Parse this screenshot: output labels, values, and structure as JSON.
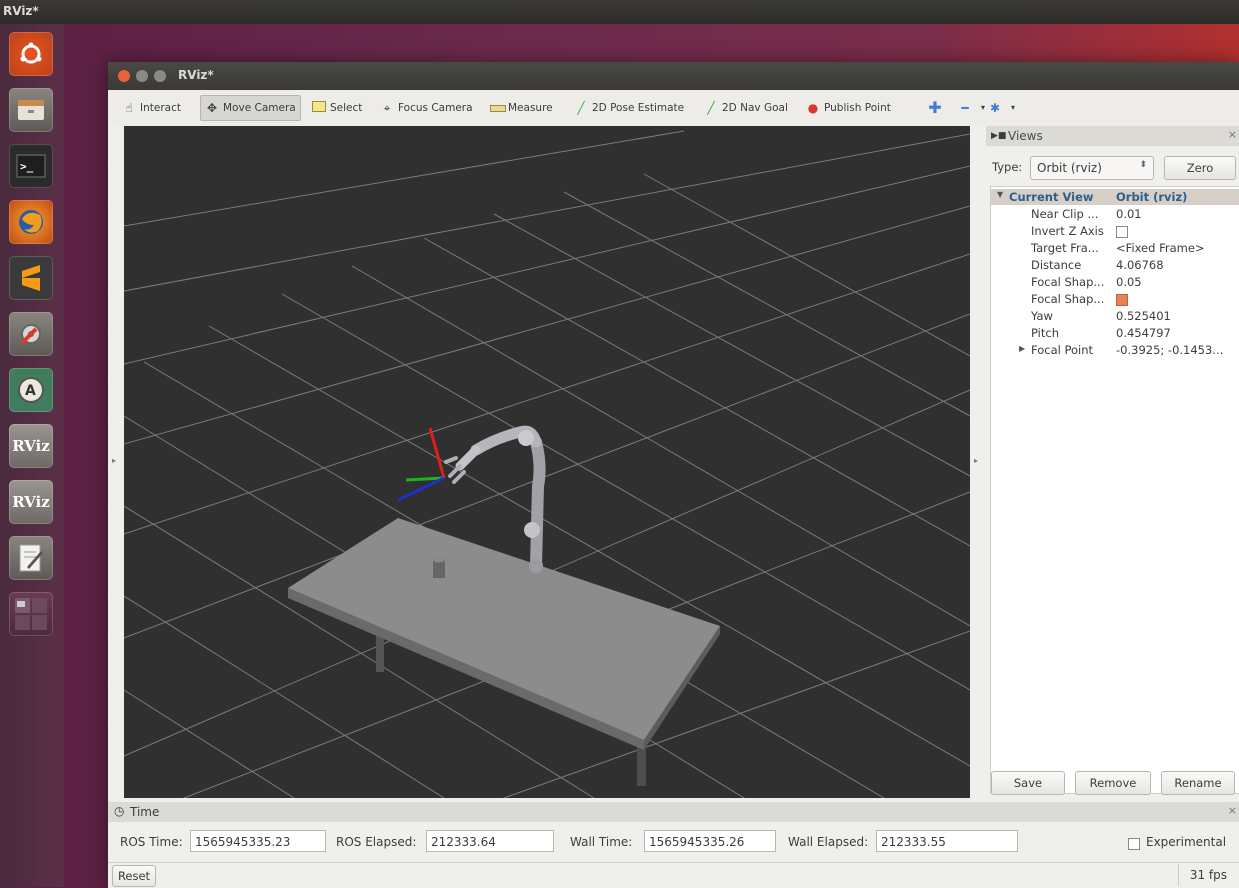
{
  "desktop": {
    "top_bar_title": "RViz*"
  },
  "launcher": {
    "items": [
      {
        "icon": "ubuntu-logo-icon"
      },
      {
        "icon": "file-manager-icon"
      },
      {
        "icon": "terminal-icon"
      },
      {
        "icon": "firefox-icon"
      },
      {
        "icon": "sublime-text-icon"
      },
      {
        "icon": "system-settings-icon"
      },
      {
        "icon": "software-updater-icon"
      },
      {
        "icon": "rviz-icon",
        "label": "RViz"
      },
      {
        "icon": "rviz-icon",
        "label": "RViz"
      },
      {
        "icon": "text-editor-icon"
      },
      {
        "icon": "workspace-switcher-icon"
      }
    ]
  },
  "window": {
    "title": "RViz*"
  },
  "toolbar": {
    "interact": "Interact",
    "move_camera": "Move Camera",
    "select": "Select",
    "focus_camera": "Focus Camera",
    "measure": "Measure",
    "pose_estimate": "2D Pose Estimate",
    "nav_goal": "2D Nav Goal",
    "publish_point": "Publish Point"
  },
  "views_panel": {
    "title": "Views",
    "type_label": "Type:",
    "type_value": "Orbit (rviz)",
    "zero_button": "Zero",
    "header_name": "Current View",
    "header_value": "Orbit (rviz)",
    "props": [
      {
        "name": "Near Clip ...",
        "value": "0.01"
      },
      {
        "name": "Invert Z Axis",
        "value": ""
      },
      {
        "name": "Target Fra...",
        "value": "<Fixed Frame>"
      },
      {
        "name": "Distance",
        "value": "4.06768"
      },
      {
        "name": "Focal Shap...",
        "value": "0.05"
      },
      {
        "name": "Focal Shap...",
        "value": ""
      },
      {
        "name": "Yaw",
        "value": "0.525401"
      },
      {
        "name": "Pitch",
        "value": "0.454797"
      },
      {
        "name": "Focal Point",
        "value": "-0.3925; -0.1453..."
      }
    ],
    "invert_z_checked": false,
    "focal_shape_fixed_checked": true,
    "save_button": "Save",
    "remove_button": "Remove",
    "rename_button": "Rename"
  },
  "time_panel": {
    "title": "Time",
    "ros_time_label": "ROS Time:",
    "ros_time_value": "1565945335.23",
    "ros_elapsed_label": "ROS Elapsed:",
    "ros_elapsed_value": "212333.64",
    "wall_time_label": "Wall Time:",
    "wall_time_value": "1565945335.26",
    "wall_elapsed_label": "Wall Elapsed:",
    "wall_elapsed_value": "212333.55",
    "experimental_label": "Experimental",
    "experimental_checked": false
  },
  "status_bar": {
    "reset_button": "Reset",
    "fps": "31 fps"
  },
  "colors": {
    "viewport_bg": "#303030",
    "accent_check": "#e4825b",
    "header_text": "#2d5f8a"
  }
}
